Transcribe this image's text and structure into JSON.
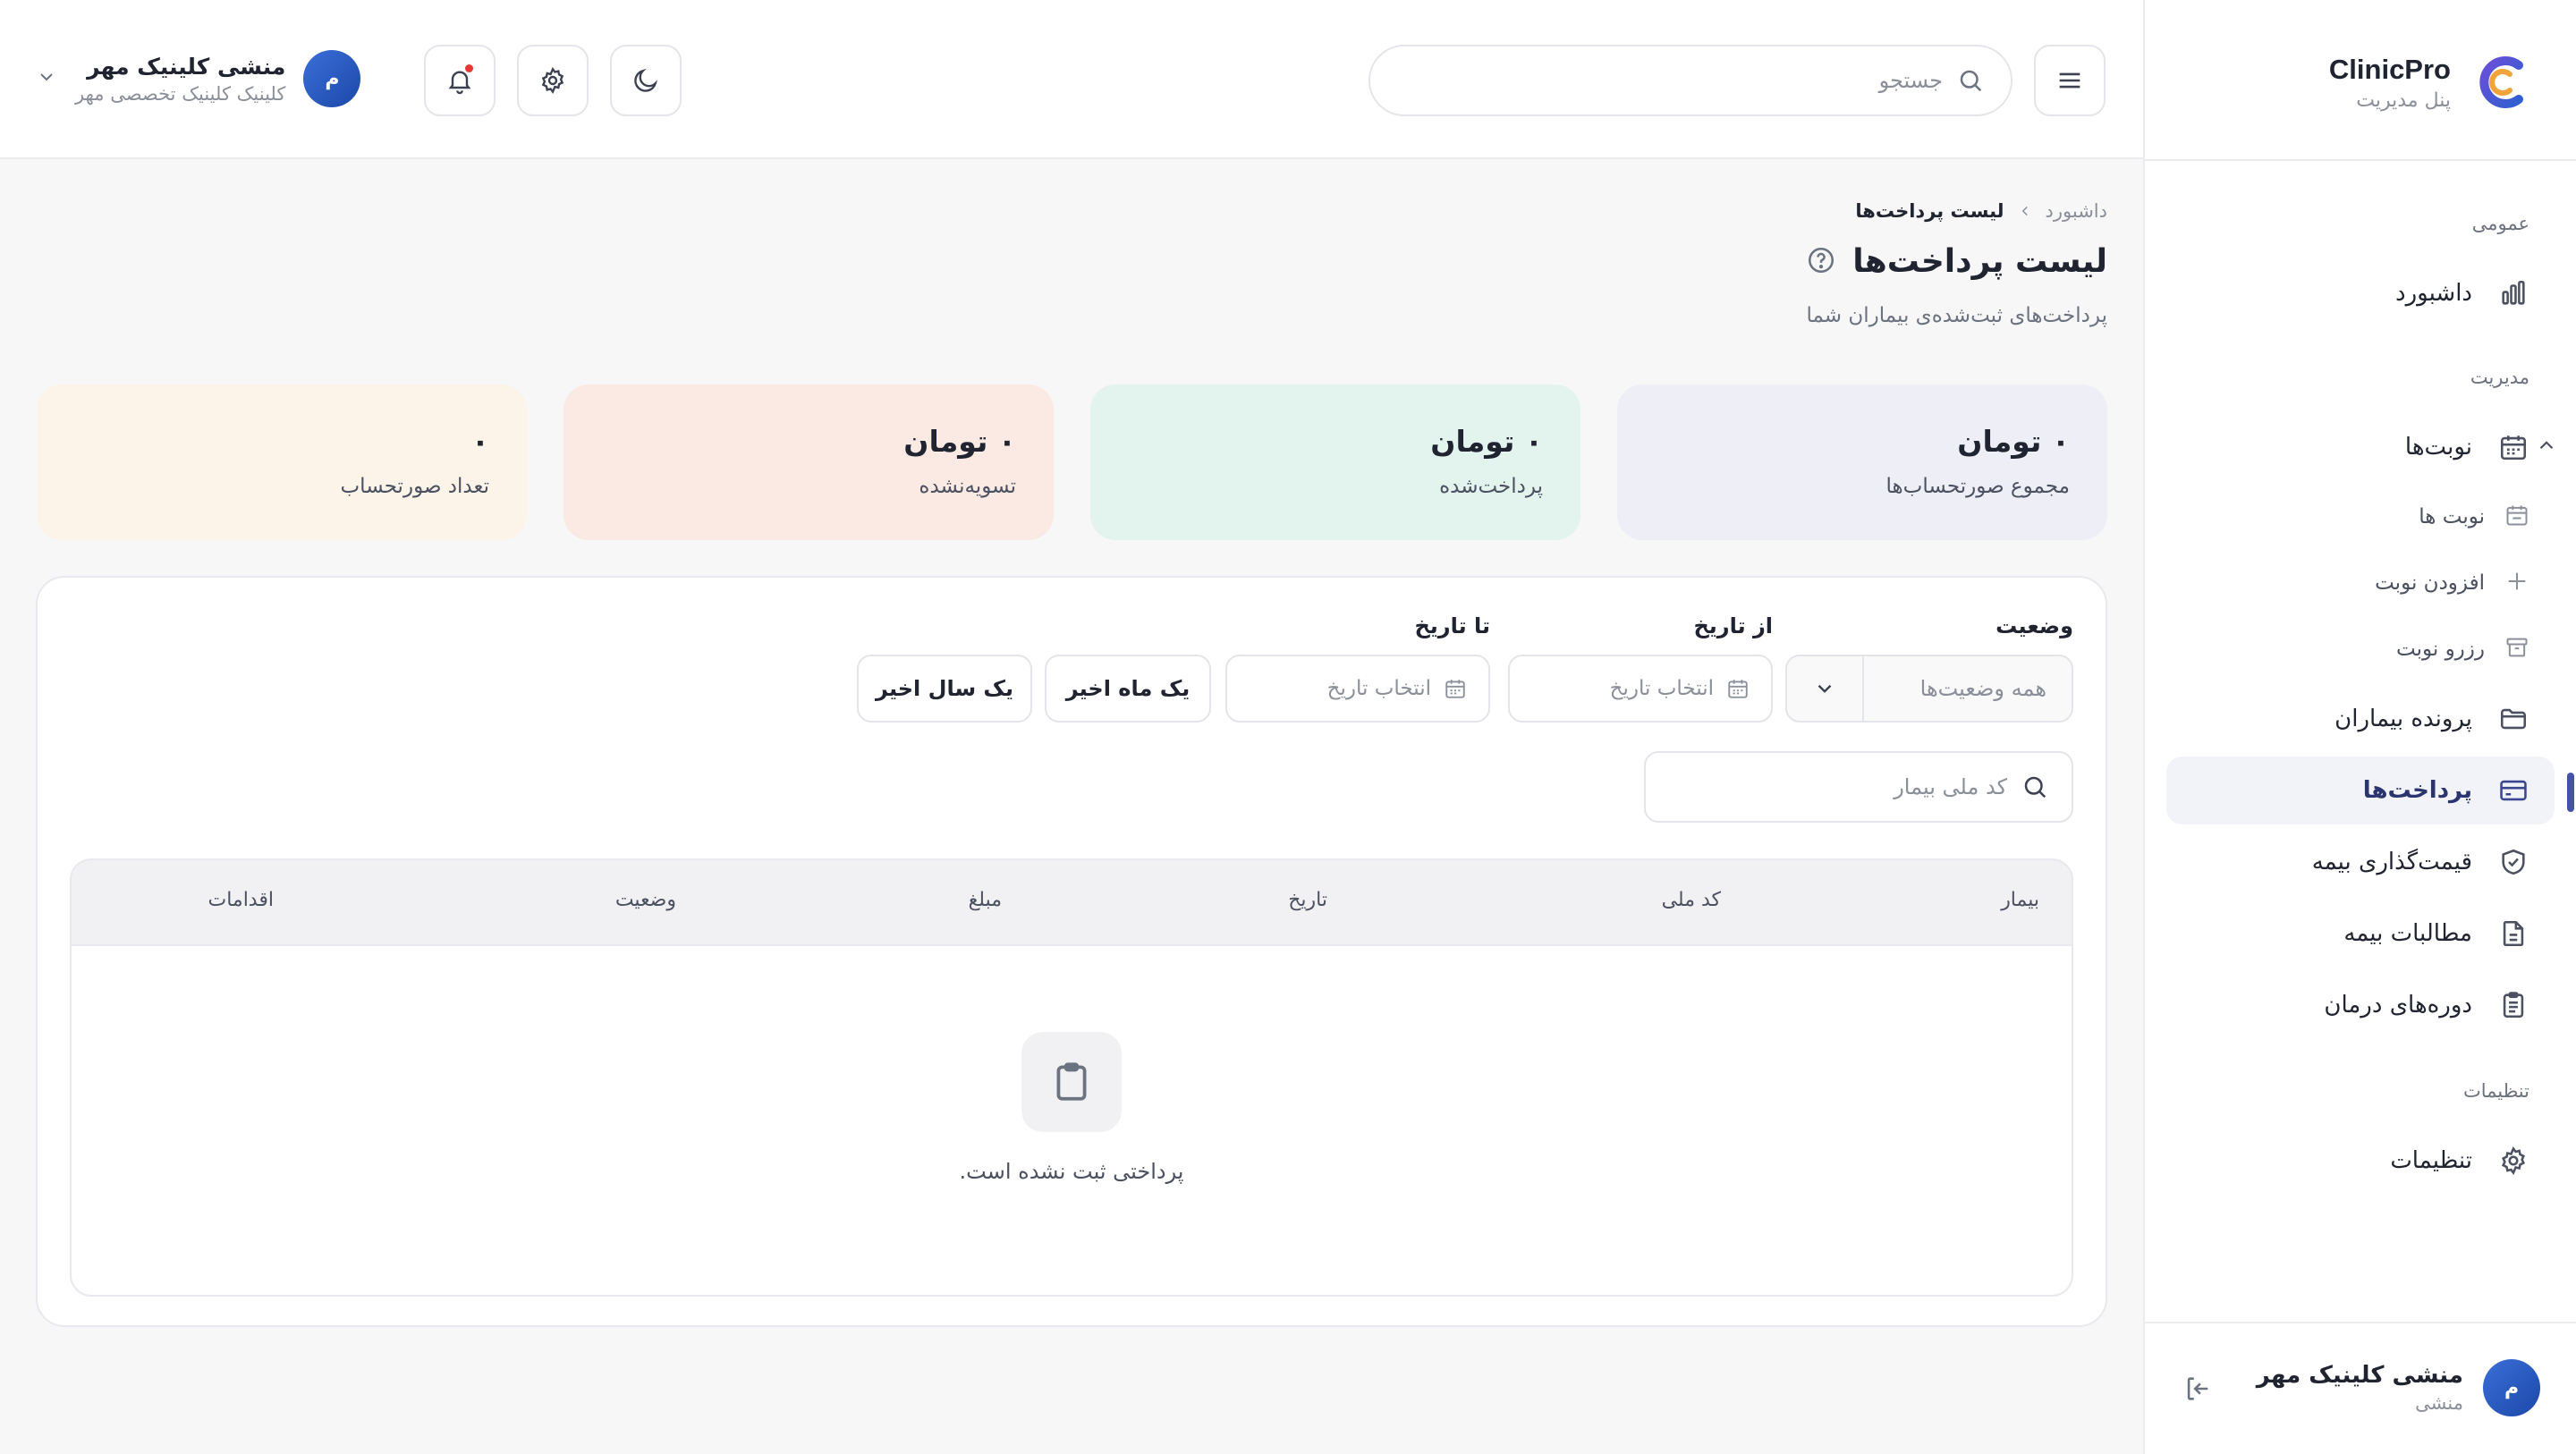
{
  "brand": {
    "title": "ClinicPro",
    "subtitle": "پنل مدیریت"
  },
  "sidebar": {
    "sections": {
      "general": "عمومی",
      "management": "مدیریت",
      "settings": "تنظیمات"
    },
    "items": {
      "dashboard": "داشبورد",
      "appointments": "نوبت‌ها",
      "appointments_list": "نوبت ها",
      "add_appointment": "افزودن نوبت",
      "reserve_appointment": "رزرو نوبت",
      "patient_records": "پرونده بیماران",
      "payments": "پرداخت‌ها",
      "insurance_pricing": "قیمت‌گذاری بیمه",
      "insurance_claims": "مطالبات بیمه",
      "treatment_courses": "دوره‌های درمان",
      "settings": "تنظیمات"
    },
    "footer": {
      "avatar": "م",
      "name": "منشی کلینیک مهر",
      "role": "منشی"
    }
  },
  "topbar": {
    "search_placeholder": "جستجو",
    "user": {
      "avatar": "م",
      "name": "منشی کلینیک مهر",
      "clinic": "کلینیک کلینیک تخصصی مهر"
    }
  },
  "breadcrumb": {
    "home": "داشبورد",
    "current": "لیست پرداخت‌ها"
  },
  "page": {
    "title": "لیست پرداخت‌ها",
    "subtitle": "پرداخت‌های ثبت‌شده‌ی بیماران شما"
  },
  "stats": [
    {
      "value": "۰ تومان",
      "label": "مجموع صورتحساب‌ها",
      "color": "#eeeef7"
    },
    {
      "value": "۰ تومان",
      "label": "پرداخت‌شده",
      "color": "#e3f3ee"
    },
    {
      "value": "۰ تومان",
      "label": "تسویه‌نشده",
      "color": "#faeae3"
    },
    {
      "value": "۰",
      "label": "تعداد صورتحساب",
      "color": "#fcf4e8"
    }
  ],
  "filters": {
    "status_label": "وضعیت",
    "status_value": "همه وضعیت‌ها",
    "from_label": "از تاریخ",
    "to_label": "تا تاریخ",
    "date_placeholder": "انتخاب تاریخ",
    "last_month": "یک ماه اخیر",
    "last_year": "یک سال اخیر",
    "nid_placeholder": "کد ملی بیمار"
  },
  "table": {
    "columns": [
      "بیمار",
      "کد ملی",
      "تاریخ",
      "مبلغ",
      "وضعیت",
      "اقدامات"
    ],
    "empty_text": "پرداختی ثبت نشده است."
  },
  "colors": {
    "accent": "#4453a6",
    "active_bg": "#f2f3f8",
    "notification": "#e53935"
  }
}
